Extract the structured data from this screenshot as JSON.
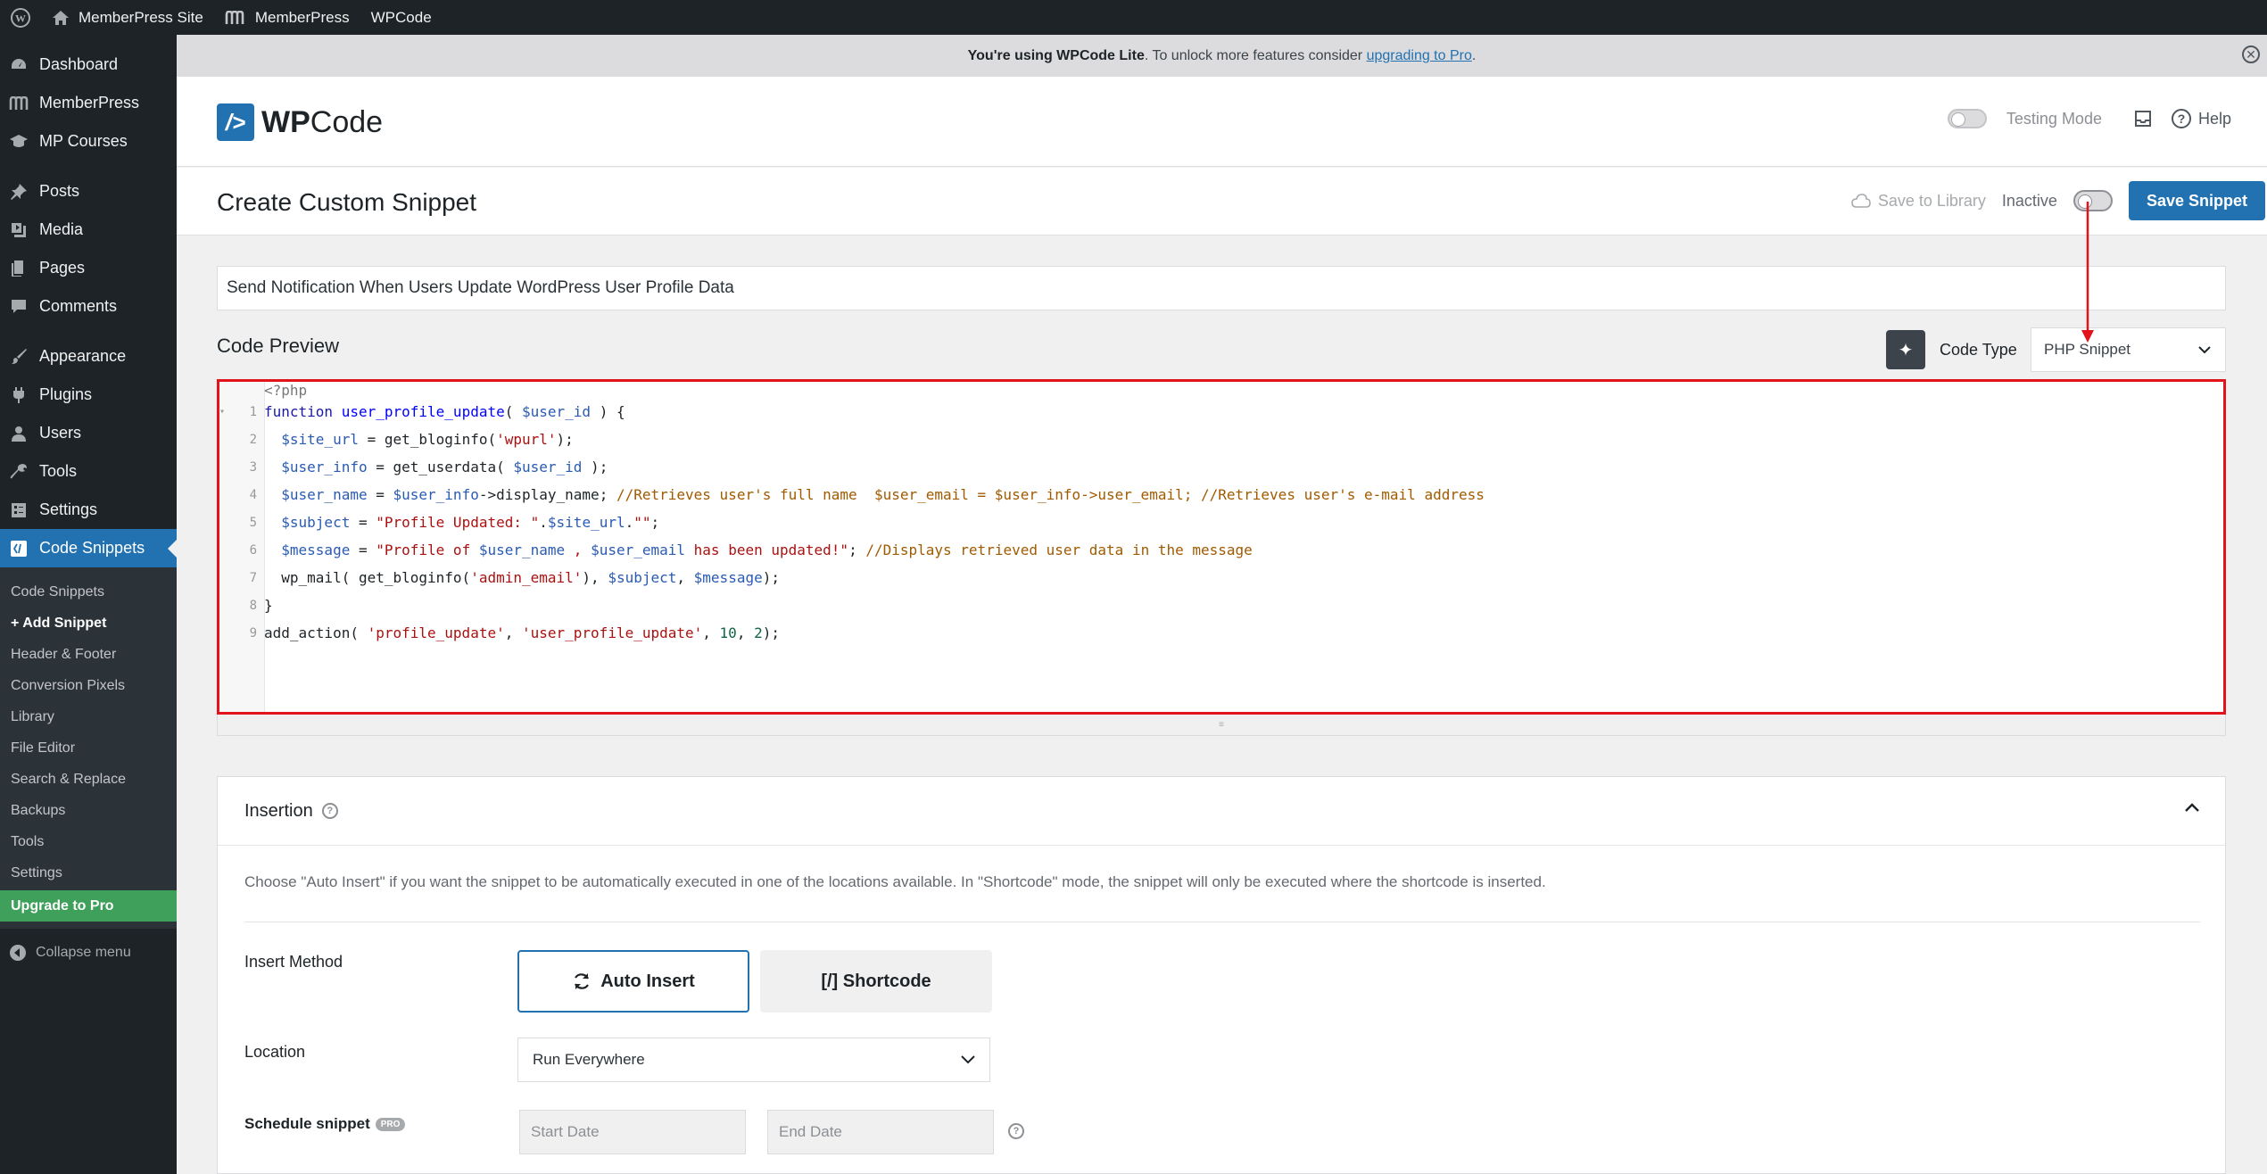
{
  "admin_bar": {
    "site_name": "MemberPress Site",
    "memberpress": "MemberPress",
    "wpcode": "WPCode"
  },
  "sidebar": {
    "items": [
      {
        "label": "Dashboard",
        "icon": "dashboard-icon"
      },
      {
        "label": "MemberPress",
        "icon": "memberpress-icon"
      },
      {
        "label": "MP Courses",
        "icon": "courses-icon"
      },
      {
        "label": "Posts",
        "icon": "pin-icon"
      },
      {
        "label": "Media",
        "icon": "media-icon"
      },
      {
        "label": "Pages",
        "icon": "pages-icon"
      },
      {
        "label": "Comments",
        "icon": "comments-icon"
      },
      {
        "label": "Appearance",
        "icon": "brush-icon"
      },
      {
        "label": "Plugins",
        "icon": "plugin-icon"
      },
      {
        "label": "Users",
        "icon": "users-icon"
      },
      {
        "label": "Tools",
        "icon": "wrench-icon"
      },
      {
        "label": "Settings",
        "icon": "settings-icon"
      },
      {
        "label": "Code Snippets",
        "icon": "code-snippets-icon"
      }
    ],
    "submenu": [
      "Code Snippets",
      "+ Add Snippet",
      "Header & Footer",
      "Conversion Pixels",
      "Library",
      "File Editor",
      "Search & Replace",
      "Backups",
      "Tools",
      "Settings",
      "Upgrade to Pro"
    ],
    "collapse": "Collapse menu"
  },
  "notice": {
    "prefix": "You're using WPCode Lite",
    "middle": ". To unlock more features consider ",
    "link": "upgrading to Pro",
    "suffix": "."
  },
  "header": {
    "logo_bold": "WP",
    "logo_rest": "Code",
    "testing_mode": "Testing Mode",
    "help": "Help"
  },
  "titlebar": {
    "title": "Create Custom Snippet",
    "save_to_library": "Save to Library",
    "status": "Inactive",
    "save_button": "Save Snippet"
  },
  "snippet": {
    "title_value": "Send Notification When Users Update WordPress User Profile Data",
    "code_preview_label": "Code Preview",
    "code_type_label": "Code Type",
    "code_type_value": "PHP Snippet",
    "php_open": "<?php",
    "code_lines": [
      {
        "n": "1",
        "parts": [
          [
            "kw",
            "function "
          ],
          [
            "fn",
            "user_profile_update"
          ],
          [
            "",
            "( "
          ],
          [
            "var",
            "$user_id"
          ],
          [
            "",
            " ) {"
          ]
        ]
      },
      {
        "n": "2",
        "parts": [
          [
            "",
            "  "
          ],
          [
            "var",
            "$site_url"
          ],
          [
            "",
            " = get_bloginfo("
          ],
          [
            "str",
            "'wpurl'"
          ],
          [
            "",
            ");"
          ]
        ]
      },
      {
        "n": "3",
        "parts": [
          [
            "",
            "  "
          ],
          [
            "var",
            "$user_info"
          ],
          [
            "",
            " = get_userdata( "
          ],
          [
            "var",
            "$user_id"
          ],
          [
            "",
            " );"
          ]
        ]
      },
      {
        "n": "4",
        "parts": [
          [
            "",
            "  "
          ],
          [
            "var",
            "$user_name"
          ],
          [
            "",
            " = "
          ],
          [
            "var",
            "$user_info"
          ],
          [
            "",
            "->display_name; "
          ],
          [
            "cm",
            "//Retrieves user's full name  $user_email = $user_info->user_email; //Retrieves user's e-mail address"
          ]
        ]
      },
      {
        "n": "5",
        "parts": [
          [
            "",
            "  "
          ],
          [
            "var",
            "$subject"
          ],
          [
            "",
            " = "
          ],
          [
            "str",
            "\"Profile Updated: \""
          ],
          [
            "",
            "."
          ],
          [
            "var",
            "$site_url"
          ],
          [
            "",
            "."
          ],
          [
            "str",
            "\"\""
          ],
          [
            "",
            ";"
          ]
        ]
      },
      {
        "n": "6",
        "parts": [
          [
            "",
            "  "
          ],
          [
            "var",
            "$message"
          ],
          [
            "",
            " = "
          ],
          [
            "str",
            "\"Profile of "
          ],
          [
            "var",
            "$user_name"
          ],
          [
            "str",
            " , "
          ],
          [
            "var",
            "$user_email"
          ],
          [
            "str",
            " has been updated!\""
          ],
          [
            "",
            "; "
          ],
          [
            "cm",
            "//Displays retrieved user data in the message"
          ]
        ]
      },
      {
        "n": "7",
        "parts": [
          [
            "",
            "  wp_mail( get_bloginfo("
          ],
          [
            "str",
            "'admin_email'"
          ],
          [
            "",
            "), "
          ],
          [
            "var",
            "$subject"
          ],
          [
            "",
            ", "
          ],
          [
            "var",
            "$message"
          ],
          [
            "",
            ");"
          ]
        ]
      },
      {
        "n": "8",
        "parts": [
          [
            "",
            "}"
          ]
        ]
      },
      {
        "n": "9",
        "parts": [
          [
            "",
            "add_action( "
          ],
          [
            "str",
            "'profile_update'"
          ],
          [
            "",
            ", "
          ],
          [
            "str",
            "'user_profile_update'"
          ],
          [
            "",
            ", "
          ],
          [
            "num",
            "10"
          ],
          [
            "",
            ", "
          ],
          [
            "num",
            "2"
          ],
          [
            "",
            ");"
          ]
        ]
      }
    ]
  },
  "insertion": {
    "heading": "Insertion",
    "description": "Choose \"Auto Insert\" if you want the snippet to be automatically executed in one of the locations available. In \"Shortcode\" mode, the snippet will only be executed where the shortcode is inserted.",
    "insert_method_label": "Insert Method",
    "auto_insert": "Auto Insert",
    "shortcode": "[/] Shortcode",
    "location_label": "Location",
    "location_value": "Run Everywhere",
    "schedule_label": "Schedule snippet",
    "pro_badge": "PRO",
    "start_date_placeholder": "Start Date",
    "end_date_placeholder": "End Date"
  },
  "colors": {
    "accent": "#2271b1",
    "highlight_border": "#e3131b",
    "upgrade": "#3fa05b"
  }
}
